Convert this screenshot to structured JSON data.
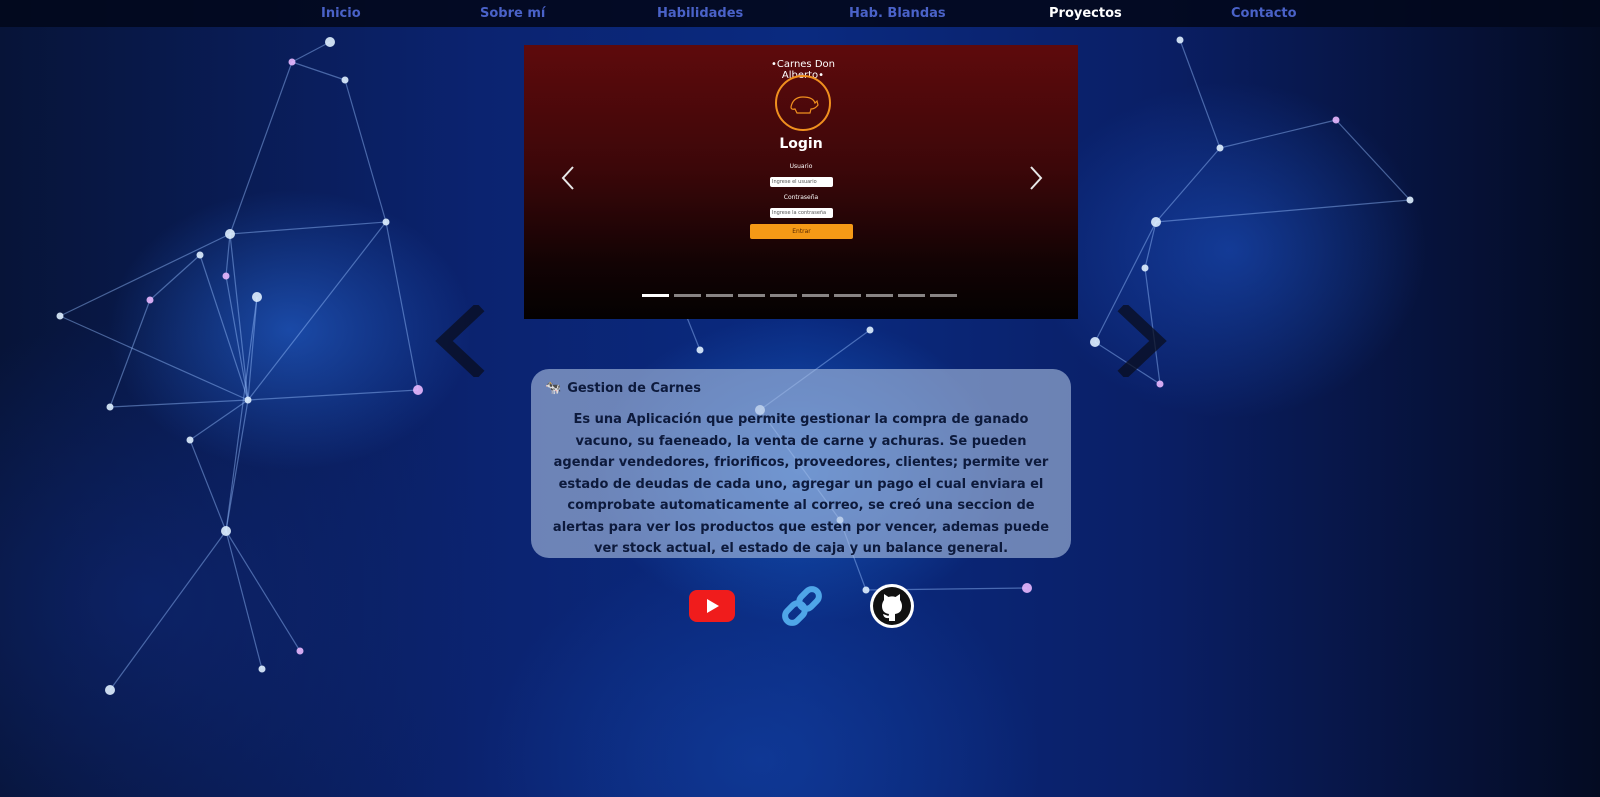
{
  "nav": {
    "items": [
      {
        "label": "Inicio"
      },
      {
        "label": "Sobre mí"
      },
      {
        "label": "Habilidades"
      },
      {
        "label": "Hab. Blandas"
      },
      {
        "label": "Proyectos"
      },
      {
        "label": "Contacto"
      }
    ],
    "active": "Proyectos"
  },
  "carousel": {
    "slide": {
      "logo_text": "•Carnes Don Alberto•",
      "title": "Login",
      "user_label": "Usuario",
      "user_placeholder": "Ingrese el usuario",
      "password_label": "Contraseña",
      "password_placeholder": "Ingrese la contraseña",
      "submit_label": "Entrar"
    },
    "slide_count": 10,
    "active_index": 0
  },
  "project": {
    "emoji": "🐄",
    "title": "Gestion de Carnes",
    "description": "Es una Aplicación que permite gestionar la compra de ganado vacuno, su faeneado, la venta de carne y achuras. Se pueden agendar vendedores, friorificos, proveedores, clientes; permite ver estado de deudas de cada uno, agregar un pago el cual enviara el comprobate automaticamente al correo, se creó una seccion de alertas para ver los productos que esten por vencer, ademas puede ver stock actual, el estado de caja y un balance general."
  },
  "colors": {
    "nav_text": "#4a62c8",
    "nav_active": "#ffffff",
    "youtube_red": "#f01c1c",
    "link_blue": "#4fa6e8",
    "button_orange": "#f59a16"
  },
  "icons": [
    "youtube-icon",
    "link-icon",
    "github-icon",
    "chevron-left-icon",
    "chevron-right-icon",
    "cow-icon"
  ]
}
